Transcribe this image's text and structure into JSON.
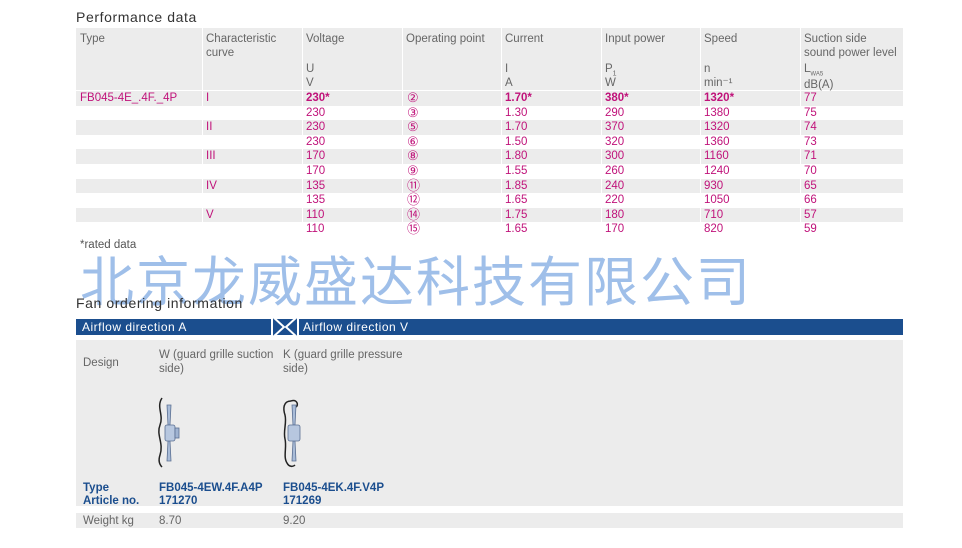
{
  "performance": {
    "title": "Performance data",
    "headers": {
      "type": "Type",
      "curve": [
        "Characteristic",
        "curve"
      ],
      "voltage": "Voltage",
      "voltage_sym": "U",
      "voltage_unit": "V",
      "op": "Operating point",
      "current": "Current",
      "current_sym": "I",
      "current_unit": "A",
      "power": "Input power",
      "power_sym": "P",
      "power_unit": "W",
      "speed": "Speed",
      "speed_sym": "n",
      "speed_unit": "min⁻¹",
      "sound": [
        "Suction side",
        "sound power level"
      ],
      "sound_sym": "L",
      "sound_sub": "WA5",
      "sound_unit": "dB(A)"
    },
    "type_value": "FB045-4E_.4F._4P",
    "rows": [
      {
        "curve": "I",
        "u": "230*",
        "op": "②",
        "i": "1.70*",
        "p": "380*",
        "n": "1320*",
        "l": "77",
        "bold": true
      },
      {
        "curve": "",
        "u": "230",
        "op": "③",
        "i": "1.30",
        "p": "290",
        "n": "1380",
        "l": "75"
      },
      {
        "curve": "II",
        "u": "230",
        "op": "⑤",
        "i": "1.70",
        "p": "370",
        "n": "1320",
        "l": "74"
      },
      {
        "curve": "",
        "u": "230",
        "op": "⑥",
        "i": "1.50",
        "p": "320",
        "n": "1360",
        "l": "73"
      },
      {
        "curve": "III",
        "u": "170",
        "op": "⑧",
        "i": "1.80",
        "p": "300",
        "n": "1160",
        "l": "71"
      },
      {
        "curve": "",
        "u": "170",
        "op": "⑨",
        "i": "1.55",
        "p": "260",
        "n": "1240",
        "l": "70"
      },
      {
        "curve": "IV",
        "u": "135",
        "op": "⑪",
        "i": "1.85",
        "p": "240",
        "n": "930",
        "l": "65"
      },
      {
        "curve": "",
        "u": "135",
        "op": "⑫",
        "i": "1.65",
        "p": "220",
        "n": "1050",
        "l": "66"
      },
      {
        "curve": "V",
        "u": "110",
        "op": "⑭",
        "i": "1.75",
        "p": "180",
        "n": "710",
        "l": "57"
      },
      {
        "curve": "",
        "u": "110",
        "op": "⑮",
        "i": "1.65",
        "p": "170",
        "n": "820",
        "l": "59"
      }
    ],
    "footnote": "*rated data"
  },
  "watermark": "北京龙威盛达科技有限公司",
  "ordering": {
    "title": "Fan ordering information",
    "airflow_a": "Airflow direction A",
    "airflow_v": "Airflow direction V",
    "design_label": "Design",
    "design_w": [
      "W (guard grille suction",
      "side)"
    ],
    "design_k": [
      "K (guard grille pressure",
      "side)"
    ],
    "type_label": "Type",
    "article_label": "Article no.",
    "type_w": "FB045-4EW.4F.A4P",
    "article_w": "171270",
    "type_k": "FB045-4EK.4F.V4P",
    "article_k": "171269",
    "weight_label": "Weight kg",
    "weight_w": "8.70",
    "weight_k": "9.20"
  },
  "colors": {
    "accent": "#c0127a",
    "bar": "#1b4e8e",
    "shade": "#ececec"
  }
}
